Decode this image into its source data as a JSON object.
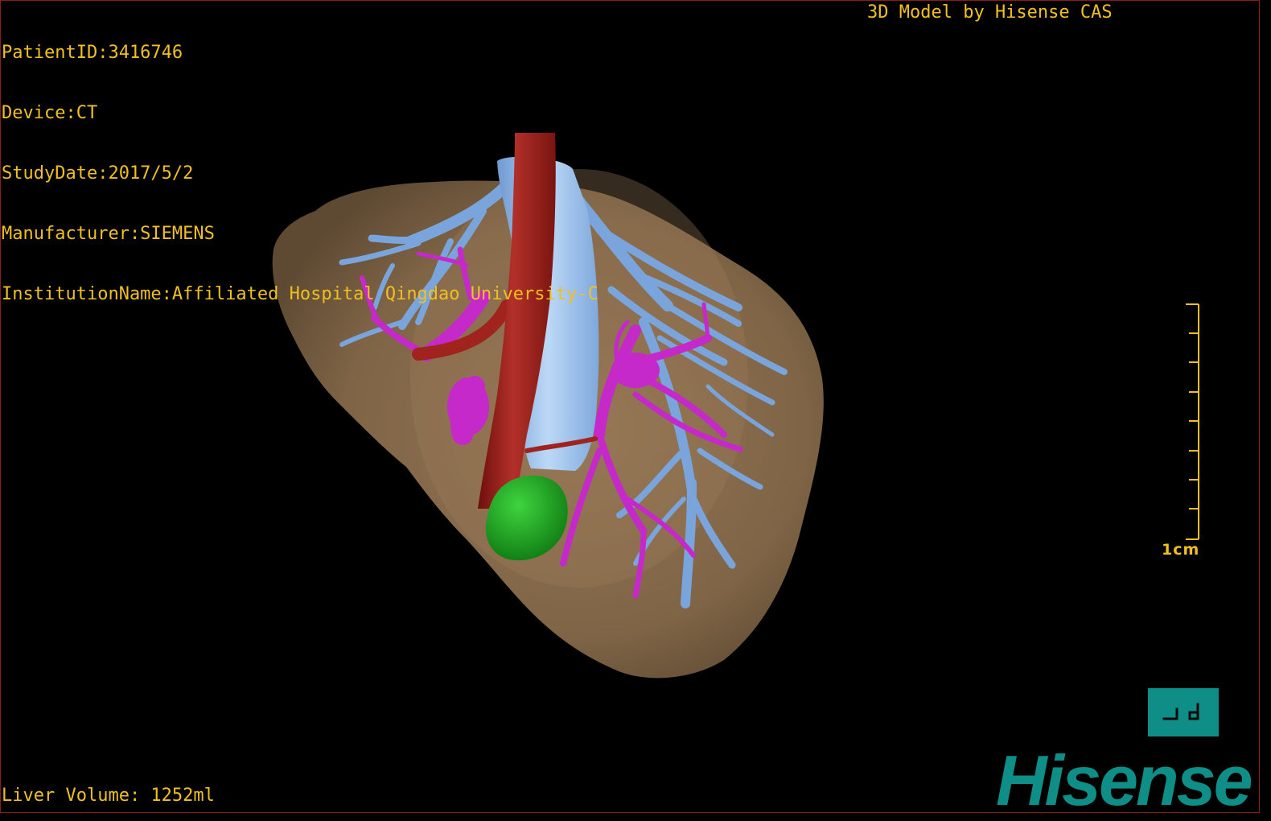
{
  "colors": {
    "overlay_text": "#f0c020",
    "brand": "#0e8e86",
    "liver": "#8a6e4d",
    "hepatic_vein": "#7aa5dc",
    "portal_vein": "#c529c9",
    "artery": "#a0231e",
    "ivc": "#9cc4f0",
    "lesion": "#1fa21f"
  },
  "meta": {
    "patient_id": "PatientID:3416746",
    "device": "Device:CT",
    "study_date": "StudyDate:2017/5/2",
    "manufacturer": "Manufacturer:SIEMENS",
    "institution": "InstitutionName:Affiliated Hospital Qingdao University-C"
  },
  "credit": "3D Model by Hisense CAS",
  "scale_bar": {
    "label": "1cm"
  },
  "liver_volume": "Liver Volume: 1252ml",
  "brand": {
    "badge_icon": "orientation-badge-icon",
    "badge_text": "┘d",
    "wordmark": "Hisense"
  }
}
